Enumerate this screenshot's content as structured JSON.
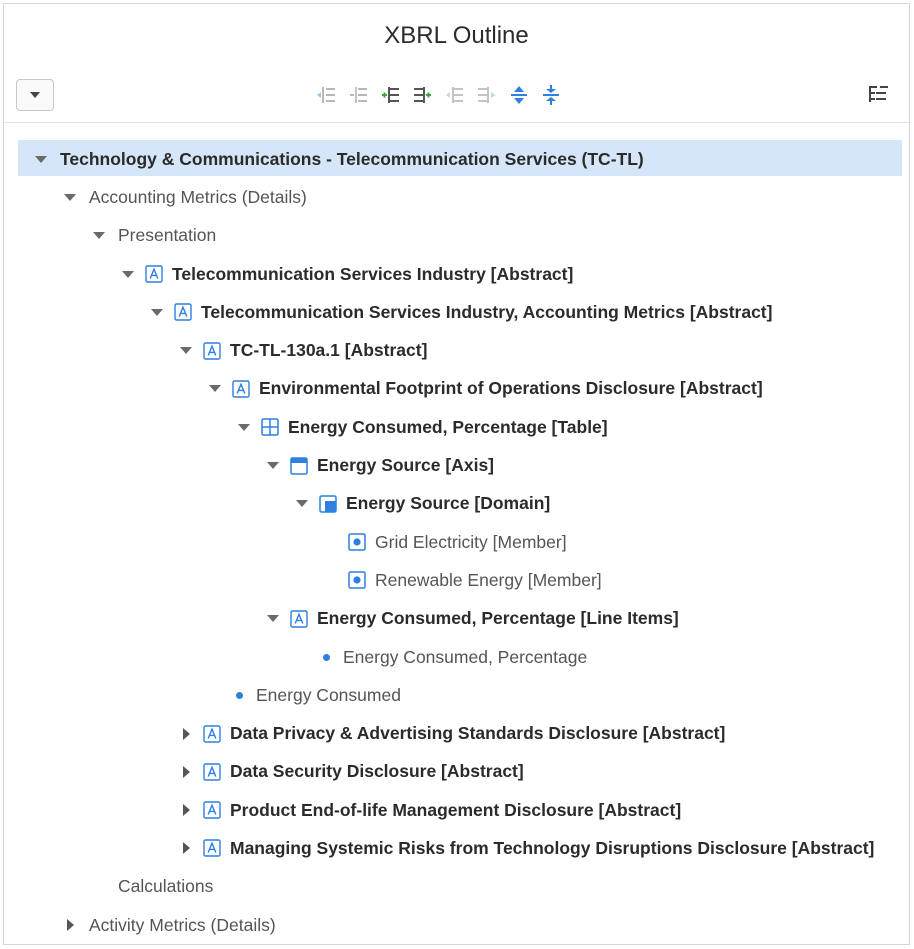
{
  "window": {
    "title": "XBRL Outline"
  },
  "toolbar": {
    "menu_icon": "chevron-down-icon",
    "buttons": [
      "indent-left-icon",
      "indent-left-alt-icon",
      "add-child-icon",
      "add-sibling-icon",
      "outdent-icon",
      "move-right-icon",
      "move-up-down-icon",
      "collapse-expand-icon"
    ],
    "filter_icon": "tree-filter-icon",
    "accent_color": "#2d7fe0"
  },
  "tree": {
    "rows": [
      {
        "label": "Technology & Communications - Telecommunication Services (TC-TL)",
        "level": 0,
        "toggle": "expanded",
        "icon": "none",
        "bold": true,
        "selected": true
      },
      {
        "label": "Accounting Metrics (Details)",
        "level": 1,
        "toggle": "expanded",
        "icon": "none",
        "bold": false
      },
      {
        "label": "Presentation",
        "level": 2,
        "toggle": "expanded",
        "icon": "none",
        "bold": false
      },
      {
        "label": "Telecommunication Services Industry [Abstract]",
        "level": 3,
        "toggle": "expanded",
        "icon": "abstract-icon",
        "bold": true
      },
      {
        "label": "Telecommunication Services Industry, Accounting Metrics [Abstract]",
        "level": 4,
        "toggle": "expanded",
        "icon": "abstract-icon",
        "bold": true
      },
      {
        "label": "TC-TL-130a.1 [Abstract]",
        "level": 5,
        "toggle": "expanded",
        "icon": "abstract-icon",
        "bold": true
      },
      {
        "label": "Environmental Footprint of Operations Disclosure [Abstract]",
        "level": 6,
        "toggle": "expanded",
        "icon": "abstract-icon",
        "bold": true
      },
      {
        "label": "Energy Consumed, Percentage [Table]",
        "level": 7,
        "toggle": "expanded",
        "icon": "table-icon",
        "bold": true
      },
      {
        "label": "Energy Source [Axis]",
        "level": 8,
        "toggle": "expanded",
        "icon": "axis-icon",
        "bold": true
      },
      {
        "label": "Energy Source [Domain]",
        "level": 9,
        "toggle": "expanded",
        "icon": "domain-icon",
        "bold": true
      },
      {
        "label": "Grid Electricity [Member]",
        "level": 10,
        "toggle": "none",
        "icon": "member-icon",
        "bold": false
      },
      {
        "label": "Renewable Energy [Member]",
        "level": 10,
        "toggle": "none",
        "icon": "member-icon",
        "bold": false
      },
      {
        "label": "Energy Consumed, Percentage [Line Items]",
        "level": 8,
        "toggle": "expanded",
        "icon": "abstract-icon",
        "bold": true
      },
      {
        "label": "Energy Consumed, Percentage",
        "level": 9,
        "toggle": "none",
        "icon": "dot-icon",
        "bold": false
      },
      {
        "label": "Energy Consumed",
        "level": 6,
        "toggle": "none",
        "icon": "dot-icon",
        "bold": false
      },
      {
        "label": "Data Privacy & Advertising Standards Disclosure [Abstract]",
        "level": 5,
        "toggle": "collapsed",
        "icon": "abstract-icon",
        "bold": true
      },
      {
        "label": "Data Security Disclosure [Abstract]",
        "level": 5,
        "toggle": "collapsed",
        "icon": "abstract-icon",
        "bold": true
      },
      {
        "label": "Product End-of-life Management Disclosure [Abstract]",
        "level": 5,
        "toggle": "collapsed",
        "icon": "abstract-icon",
        "bold": true
      },
      {
        "label": "Managing Systemic Risks from Technology Disruptions Disclosure [Abstract]",
        "level": 5,
        "toggle": "collapsed",
        "icon": "abstract-icon",
        "bold": true
      },
      {
        "label": "Calculations",
        "level": 2,
        "toggle": "none",
        "icon": "none",
        "bold": false
      },
      {
        "label": "Activity Metrics (Details)",
        "level": 1,
        "toggle": "collapsed",
        "icon": "none",
        "bold": false
      }
    ]
  }
}
